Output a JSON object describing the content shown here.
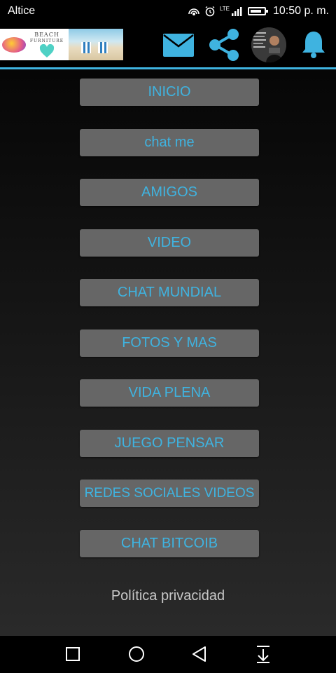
{
  "statusbar": {
    "carrier": "Altice",
    "time": "10:50 p. m.",
    "network": "LTE",
    "battery_level": 0.85,
    "icons": [
      "hotspot-icon",
      "alarm-icon",
      "signal-icon",
      "battery-icon"
    ]
  },
  "appbar": {
    "ad": {
      "line1": "BEACH",
      "line2": "FURNITURE"
    },
    "icons": [
      "mail-icon",
      "share-icon",
      "profile-avatar",
      "bell-icon"
    ],
    "accent_color": "#3fb3e0"
  },
  "menu": {
    "items": [
      {
        "label": "INICIO"
      },
      {
        "label": "chat me"
      },
      {
        "label": "AMIGOS"
      },
      {
        "label": "VIDEO"
      },
      {
        "label": "CHAT MUNDIAL"
      },
      {
        "label": "FOTOS Y MAS"
      },
      {
        "label": "VIDA PLENA"
      },
      {
        "label": "JUEGO PENSAR"
      },
      {
        "label": "REDES SOCIALES VIDEOS"
      },
      {
        "label": "CHAT BITCOIB"
      }
    ],
    "button_color": "#666666",
    "text_color": "#3fb3e0"
  },
  "footer": {
    "privacy_link": "Política privacidad"
  },
  "navbar": {
    "icons": [
      "recents-icon",
      "home-icon",
      "back-icon",
      "notification-pull-icon"
    ]
  }
}
